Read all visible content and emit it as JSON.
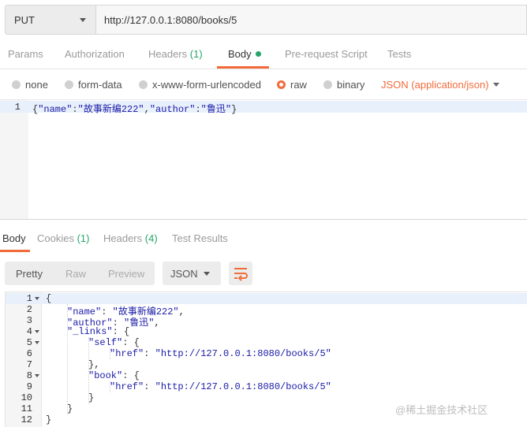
{
  "request": {
    "method": "PUT",
    "url": "http://127.0.0.1:8080/books/5"
  },
  "request_tabs": [
    {
      "label": "Params",
      "count": ""
    },
    {
      "label": "Authorization",
      "count": ""
    },
    {
      "label": "Headers",
      "count": "(1)"
    },
    {
      "label": "Body",
      "count": ""
    },
    {
      "label": "Pre-request Script",
      "count": ""
    },
    {
      "label": "Tests",
      "count": ""
    }
  ],
  "active_request_tab": "Body",
  "body_types": [
    {
      "label": "none",
      "checked": false
    },
    {
      "label": "form-data",
      "checked": false
    },
    {
      "label": "x-www-form-urlencoded",
      "checked": false
    },
    {
      "label": "raw",
      "checked": true
    },
    {
      "label": "binary",
      "checked": false
    }
  ],
  "raw_format": "JSON (application/json)",
  "request_body": {
    "line_numbers": [
      "1"
    ],
    "lines": [
      [
        {
          "t": "{",
          "c": "p"
        },
        {
          "t": "\"name\"",
          "c": "k"
        },
        {
          "t": ":",
          "c": "p"
        },
        {
          "t": "\"故事新编222\"",
          "c": "s"
        },
        {
          "t": ",",
          "c": "p"
        },
        {
          "t": "\"author\"",
          "c": "k"
        },
        {
          "t": ":",
          "c": "p"
        },
        {
          "t": "\"鲁迅\"",
          "c": "s"
        },
        {
          "t": "}",
          "c": "p"
        }
      ]
    ]
  },
  "response_tabs": [
    {
      "label": "Body",
      "count": ""
    },
    {
      "label": "Cookies",
      "count": "(1)"
    },
    {
      "label": "Headers",
      "count": "(4)"
    },
    {
      "label": "Test Results",
      "count": ""
    }
  ],
  "active_response_tab": "Body",
  "view_modes": [
    "Pretty",
    "Raw",
    "Preview"
  ],
  "active_view_mode": "Pretty",
  "response_format": "JSON",
  "wrap_icon": "wrap-lines-icon",
  "response_body": {
    "lines": [
      {
        "n": "1",
        "fold": true,
        "indent": 0,
        "parts": [
          {
            "t": "{",
            "c": "p"
          }
        ]
      },
      {
        "n": "2",
        "fold": false,
        "indent": 1,
        "parts": [
          {
            "t": "\"name\"",
            "c": "k"
          },
          {
            "t": ": ",
            "c": "p"
          },
          {
            "t": "\"故事新编222\"",
            "c": "s"
          },
          {
            "t": ",",
            "c": "p"
          }
        ]
      },
      {
        "n": "3",
        "fold": false,
        "indent": 1,
        "parts": [
          {
            "t": "\"author\"",
            "c": "k"
          },
          {
            "t": ": ",
            "c": "p"
          },
          {
            "t": "\"鲁迅\"",
            "c": "s"
          },
          {
            "t": ",",
            "c": "p"
          }
        ]
      },
      {
        "n": "4",
        "fold": true,
        "indent": 1,
        "parts": [
          {
            "t": "\"_links\"",
            "c": "k"
          },
          {
            "t": ": {",
            "c": "p"
          }
        ]
      },
      {
        "n": "5",
        "fold": true,
        "indent": 2,
        "parts": [
          {
            "t": "\"self\"",
            "c": "k"
          },
          {
            "t": ": {",
            "c": "p"
          }
        ]
      },
      {
        "n": "6",
        "fold": false,
        "indent": 3,
        "parts": [
          {
            "t": "\"href\"",
            "c": "k"
          },
          {
            "t": ": ",
            "c": "p"
          },
          {
            "t": "\"http://127.0.0.1:8080/books/5\"",
            "c": "s"
          }
        ]
      },
      {
        "n": "7",
        "fold": false,
        "indent": 2,
        "parts": [
          {
            "t": "},",
            "c": "p"
          }
        ]
      },
      {
        "n": "8",
        "fold": true,
        "indent": 2,
        "parts": [
          {
            "t": "\"book\"",
            "c": "k"
          },
          {
            "t": ": {",
            "c": "p"
          }
        ]
      },
      {
        "n": "9",
        "fold": false,
        "indent": 3,
        "parts": [
          {
            "t": "\"href\"",
            "c": "k"
          },
          {
            "t": ": ",
            "c": "p"
          },
          {
            "t": "\"http://127.0.0.1:8080/books/5\"",
            "c": "s"
          }
        ]
      },
      {
        "n": "10",
        "fold": false,
        "indent": 2,
        "parts": [
          {
            "t": "}",
            "c": "p"
          }
        ]
      },
      {
        "n": "11",
        "fold": false,
        "indent": 1,
        "parts": [
          {
            "t": "}",
            "c": "p"
          }
        ]
      },
      {
        "n": "12",
        "fold": false,
        "indent": 0,
        "parts": [
          {
            "t": "}",
            "c": "p"
          }
        ]
      }
    ]
  },
  "watermark": "@稀土掘金技术社区",
  "colors": {
    "accent": "#f26b3a",
    "count_green": "#26a56a",
    "json_string": "#1a1aa6"
  }
}
